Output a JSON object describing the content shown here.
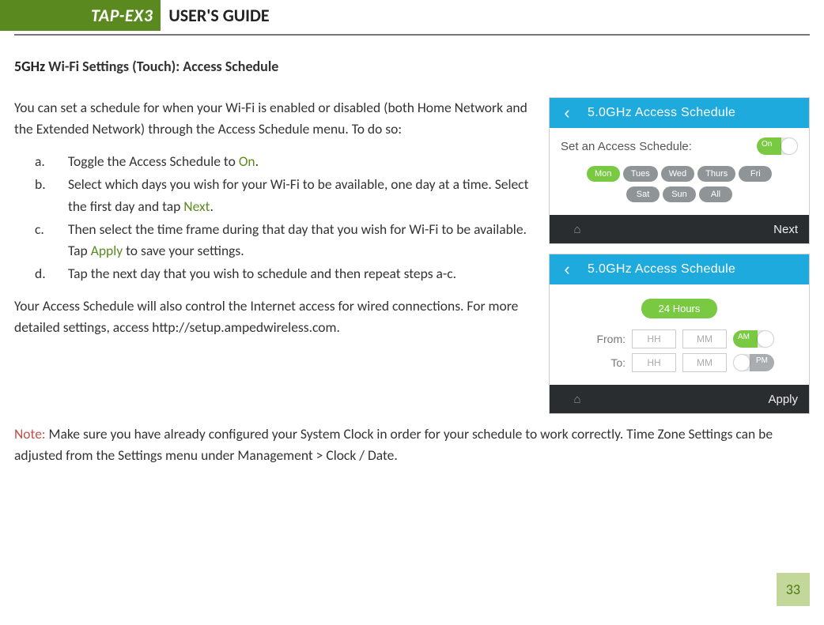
{
  "header": {
    "badge": "TAP-EX3",
    "title": "USER'S GUIDE"
  },
  "section_title_prefix": "5GHz",
  "section_title_rest": " Wi-Fi Settings (Touch): Access Schedule",
  "intro": "You can set a schedule for when your Wi-Fi is enabled or disabled (both Home Network and the Extended Network) through the Access Schedule menu. To do so:",
  "steps": {
    "a": {
      "marker": "a.",
      "pre": "Toggle the Access Schedule to ",
      "hl": "On",
      "post": "."
    },
    "b": {
      "marker": "b.",
      "pre": "Select which days you wish for your Wi-Fi to be available, one day at a time. Select the first day and tap ",
      "hl": "Next",
      "post": "."
    },
    "c": {
      "marker": "c.",
      "pre": "Then select the time frame during that day that you wish for Wi-Fi to be available. Tap ",
      "hl": "Apply",
      "post": " to save your settings."
    },
    "d": {
      "marker": "d.",
      "text": "Tap the next day that you wish to schedule and then repeat steps a-c."
    }
  },
  "outro": "Your Access Schedule will also control the Internet access for wired connections. For more detailed settings, access http://setup.ampedwireless.com.",
  "note_label": "Note:",
  "note_text": "  Make sure you have already configured your System Clock in order for your schedule to work correctly. Time Zone Settings can be adjusted from the Settings menu under Management > Clock / Date.",
  "page_number": "33",
  "fig1": {
    "title": "5.0GHz Access Schedule",
    "row_label": "Set an Access Schedule:",
    "toggle_label": "On",
    "days_r1": [
      "Mon",
      "Tues",
      "Wed",
      "Thurs",
      "Fri"
    ],
    "days_r2": [
      "Sat",
      "Sun",
      "All"
    ],
    "footer_action": "Next"
  },
  "fig2": {
    "title": "5.0GHz Access Schedule",
    "bigpill": "24 Hours",
    "from_label": "From:",
    "to_label": "To:",
    "hh": "HH",
    "mm": "MM",
    "am": "AM",
    "pm": "PM",
    "footer_action": "Apply"
  }
}
